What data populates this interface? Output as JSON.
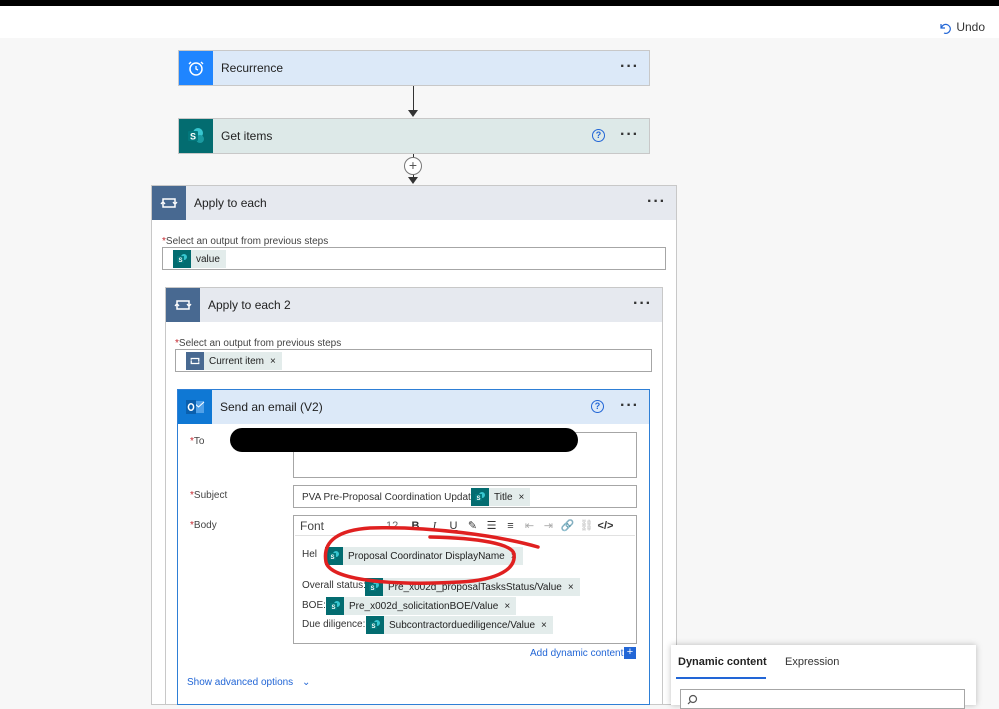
{
  "command_bar": {
    "undo_label": "Undo"
  },
  "steps": {
    "recurrence": {
      "title": "Recurrence",
      "menu": "···"
    },
    "get_items": {
      "title": "Get items",
      "menu": "···",
      "help": "?"
    },
    "apply_each": {
      "title": "Apply to each",
      "menu": "···",
      "select_label": "Select an output from previous steps",
      "token": "value"
    },
    "apply_each_2": {
      "title": "Apply to each 2",
      "menu": "···",
      "select_label": "Select an output from previous steps",
      "token": "Current item"
    },
    "send_email": {
      "title": "Send an email (V2)",
      "menu": "···",
      "help": "?",
      "to_label": "To",
      "subject_label": "Subject",
      "subject_prefix": "PVA Pre-Proposal Coordination Update:",
      "subject_token": "Title",
      "body_label": "Body",
      "toolbar": {
        "font": "Font",
        "size": "12"
      },
      "greeting": "Hel",
      "greeting_token": "Proposal Coordinator DisplayName",
      "lines": [
        {
          "label": "Overall status:",
          "token": "Pre_x002d_proposalTasksStatus/Value"
        },
        {
          "label": "BOE:",
          "token": "Pre_x002d_solicitationBOE/Value"
        },
        {
          "label": "Due diligence:",
          "token": "Subcontractorduediligence/Value"
        }
      ],
      "add_dynamic": "Add dynamic content",
      "show_advanced": "Show advanced options"
    }
  },
  "dynamic_panel": {
    "tab_dynamic": "Dynamic content",
    "tab_expression": "Expression"
  },
  "colors": {
    "recurrence_head": "#dce9f8",
    "recurrence_icon": "#1f85ff",
    "sharepoint_head": "#dde9e8",
    "sharepoint_icon": "#036c70",
    "loop_head": "#e6e9ef",
    "loop_icon": "#486991",
    "outlook_icon": "#0f78d4",
    "accent": "#2266d6",
    "annotation": "#e02020"
  }
}
